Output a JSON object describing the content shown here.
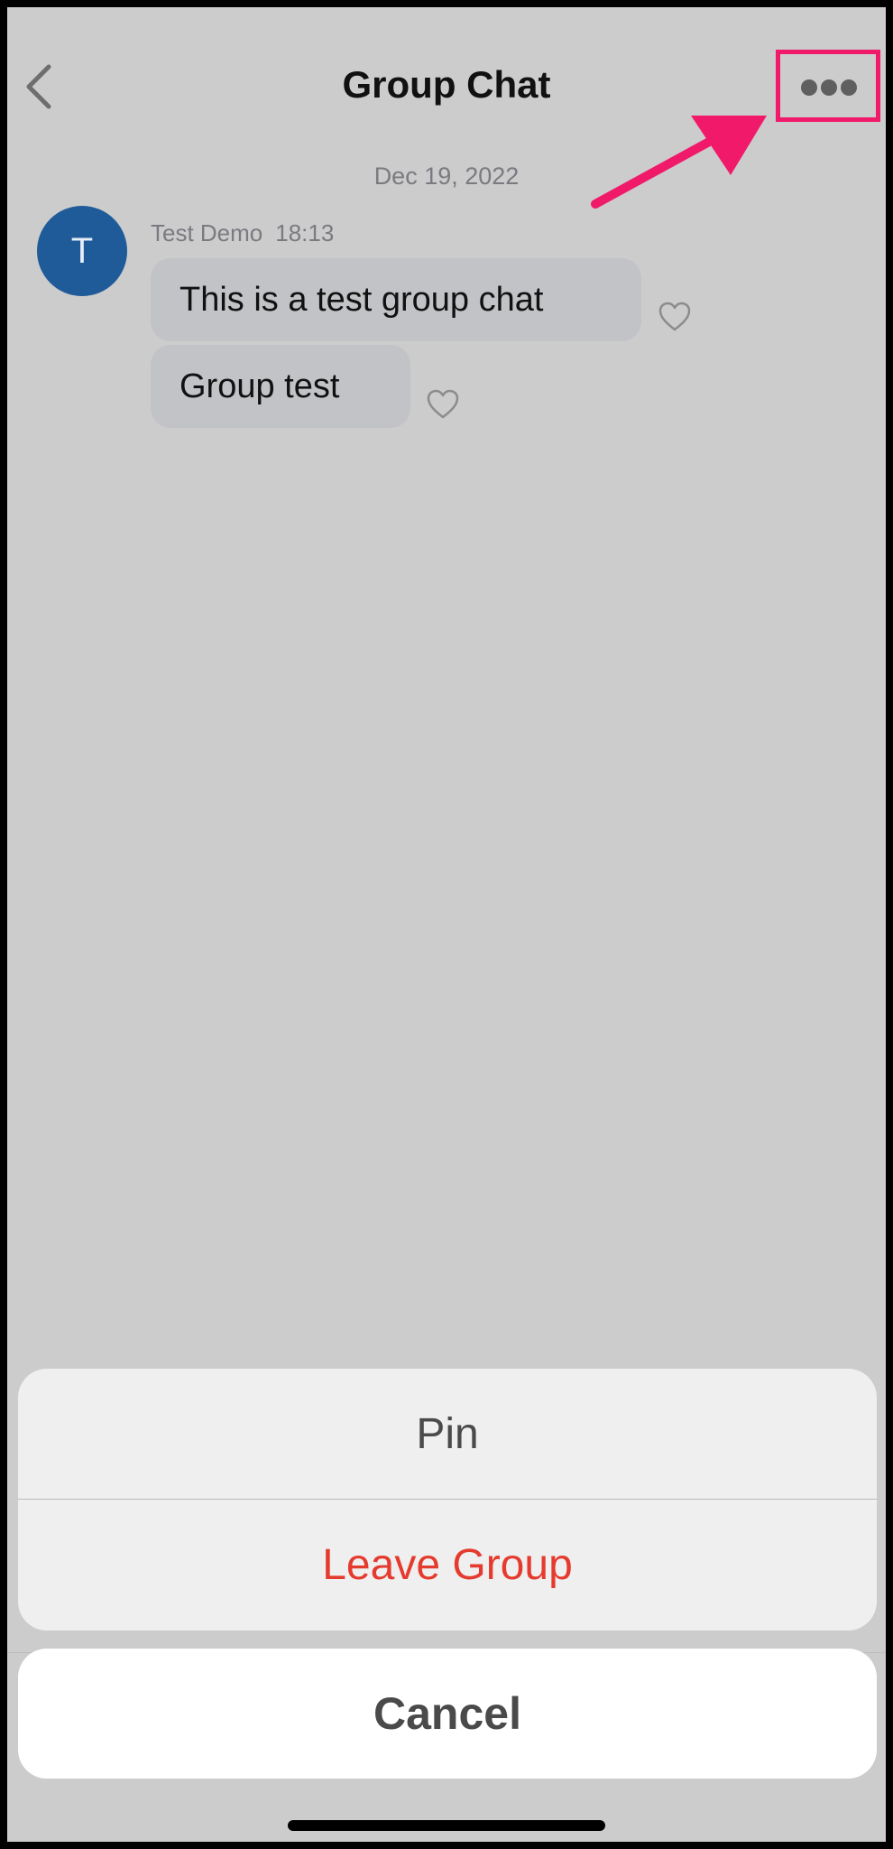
{
  "header": {
    "title": "Group Chat",
    "back_icon": "chevron-left-icon",
    "more_icon": "ellipsis-icon"
  },
  "annotation": {
    "highlight_color": "#f0196a"
  },
  "chat": {
    "date": "Dec 19, 2022",
    "sender": {
      "avatar_letter": "T",
      "avatar_color": "#1f5a99",
      "name": "Test Demo",
      "time": "18:13"
    },
    "messages": [
      {
        "text": "This is a test group chat"
      },
      {
        "text": "Group test"
      }
    ]
  },
  "action_sheet": {
    "items": [
      {
        "label": "Pin",
        "color": "#4a4a4a"
      },
      {
        "label": "Leave Group",
        "color": "#e53b2e"
      }
    ],
    "cancel_label": "Cancel"
  },
  "colors": {
    "background": "#cccccc",
    "bubble": "#c2c3c6",
    "sheet": "#efefef",
    "cancel": "#ffffff"
  }
}
